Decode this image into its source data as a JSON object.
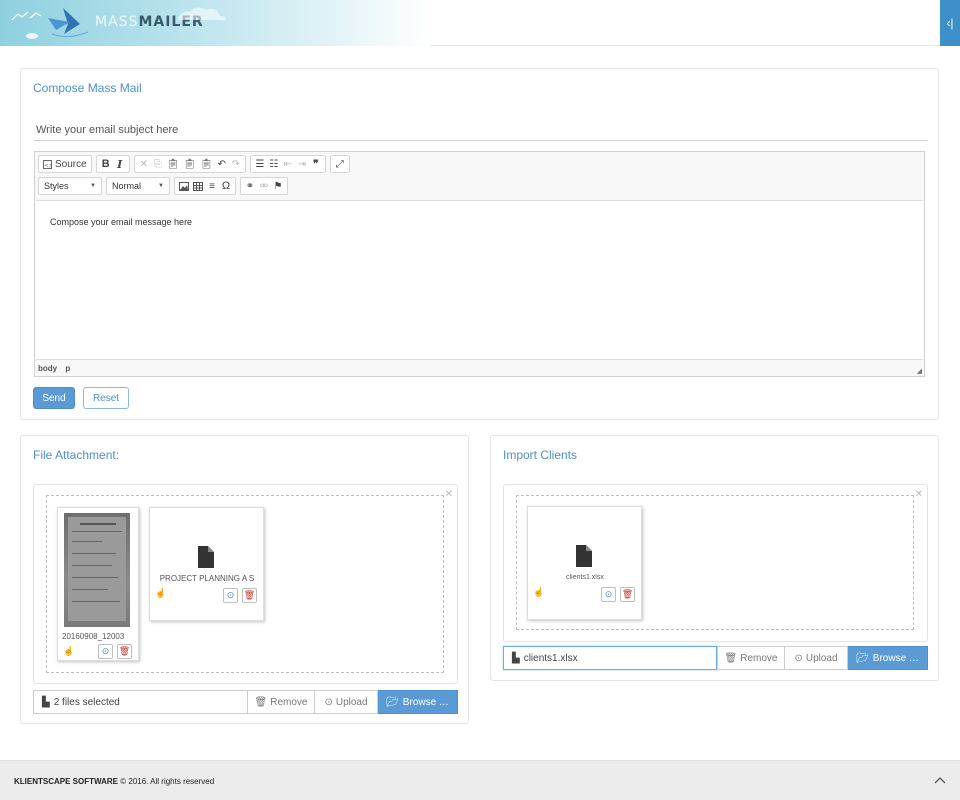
{
  "header": {
    "brand_light": "MASS",
    "brand_bold": "MAILER",
    "toggle_icon": "‹|",
    "brand_color": "#8fd0df",
    "accent": "#3d8fc7"
  },
  "compose": {
    "title": "Compose Mass Mail",
    "subject_placeholder": "Write your email subject here",
    "toolbar": {
      "source": "Source",
      "bold": "B",
      "italic": "I",
      "styles": "Styles",
      "format": "Normal"
    },
    "body_text": "Compose your email message here",
    "path": [
      "body",
      "p"
    ],
    "send": "Send",
    "reset": "Reset"
  },
  "attachments": {
    "title": "File Attachment:",
    "files": [
      {
        "name": "20160908_12003"
      },
      {
        "name": "PROJECT PLANNING A S"
      }
    ],
    "caption": "2 files selected",
    "remove": "Remove",
    "upload": "Upload",
    "browse": "Browse …"
  },
  "import": {
    "title": "Import Clients",
    "files": [
      {
        "name": "clients1.xlsx"
      }
    ],
    "caption": "clients1.xlsx",
    "remove": "Remove",
    "upload": "Upload",
    "browse": "Browse …"
  },
  "footer": {
    "company": "KLIENTSCAPE SOFTWARE",
    "rights": "© 2016. All rights reserved"
  }
}
